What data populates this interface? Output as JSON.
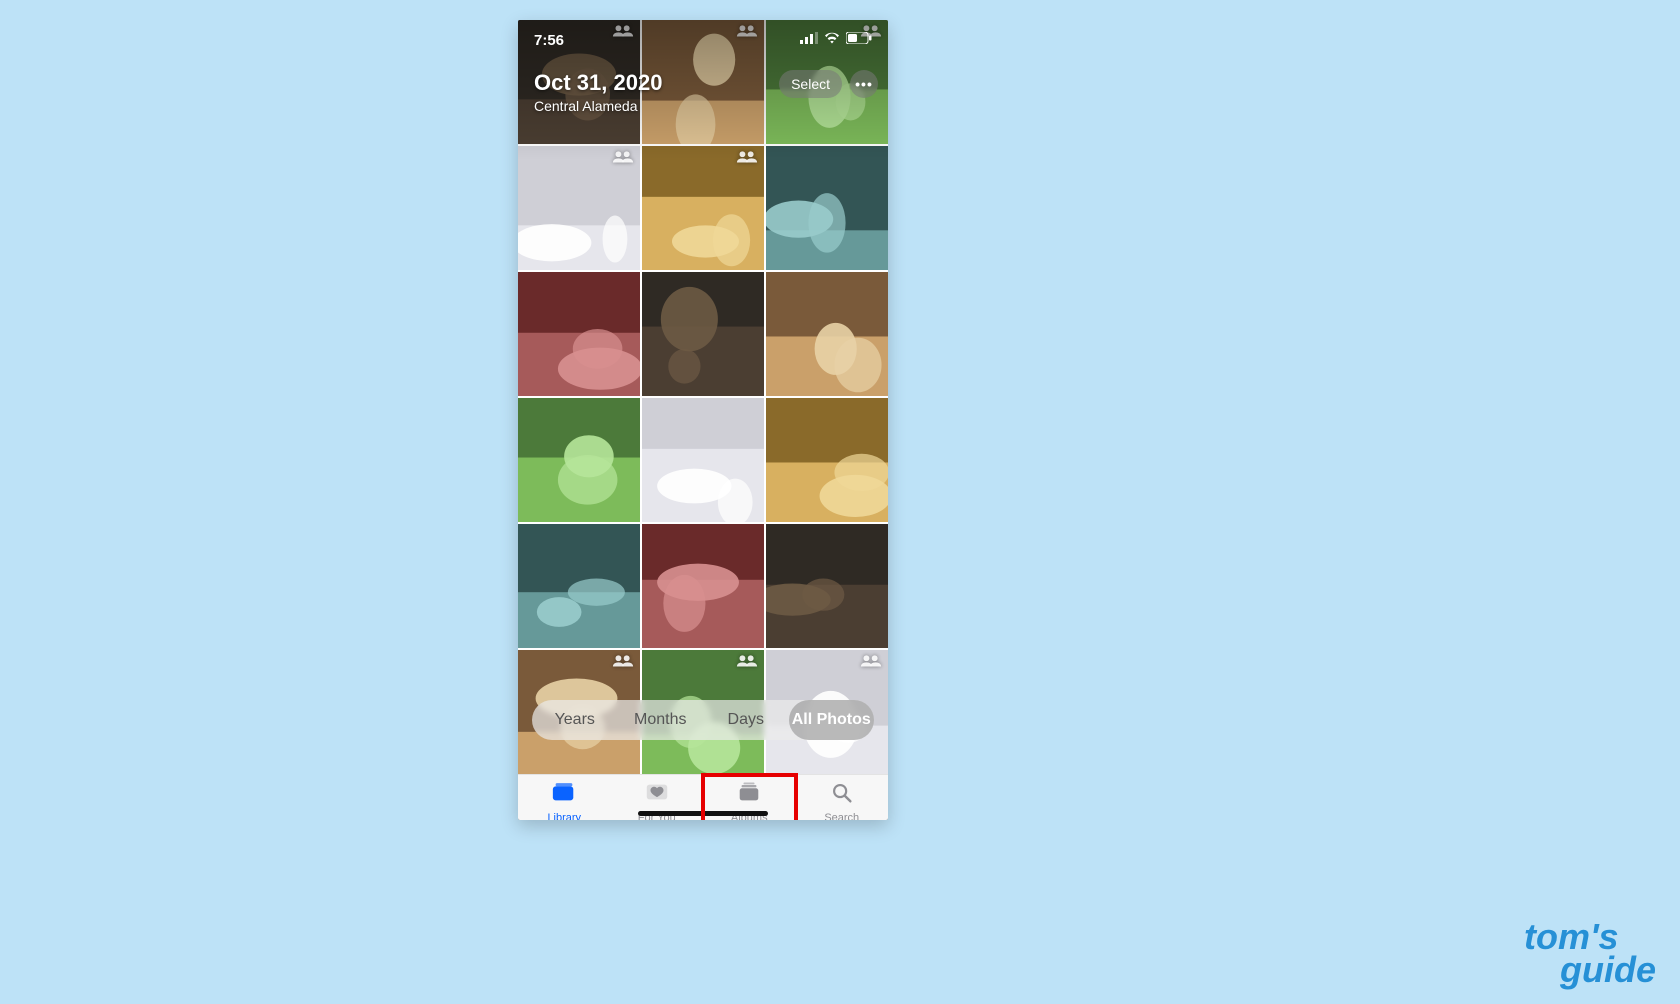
{
  "watermark": {
    "line1": "tom's",
    "line2": "guide"
  },
  "statusbar": {
    "time": "7:56"
  },
  "header": {
    "date": "Oct 31, 2020",
    "location": "Central Alameda"
  },
  "topright": {
    "select_label": "Select",
    "more_label": "•••"
  },
  "segmented": {
    "options": [
      {
        "label": "Years",
        "active": false
      },
      {
        "label": "Months",
        "active": false
      },
      {
        "label": "Days",
        "active": false
      },
      {
        "label": "All Photos",
        "active": true
      }
    ]
  },
  "tabbar": {
    "tabs": [
      {
        "label": "Library",
        "active": true
      },
      {
        "label": "For You",
        "active": false
      },
      {
        "label": "Albums",
        "active": false,
        "highlighted": true
      },
      {
        "label": "Search",
        "active": false
      }
    ]
  },
  "grid": {
    "rows": 6,
    "cols": 3,
    "thumbs": [
      {
        "people": true
      },
      {
        "people": true
      },
      {
        "people": true
      },
      {
        "people": true
      },
      {
        "people": true
      },
      {
        "people": false
      },
      {
        "people": false
      },
      {
        "people": false
      },
      {
        "people": false
      },
      {
        "people": false
      },
      {
        "people": false
      },
      {
        "people": false
      },
      {
        "people": false
      },
      {
        "people": false
      },
      {
        "people": false
      },
      {
        "people": true
      },
      {
        "people": true
      },
      {
        "people": true
      }
    ]
  }
}
